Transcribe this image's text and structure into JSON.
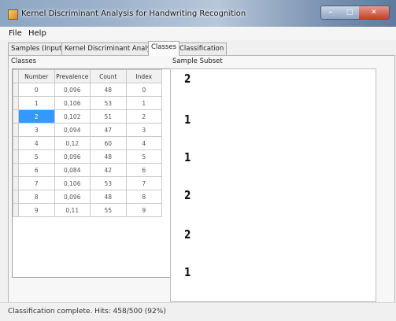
{
  "window": {
    "title": "Kernel Discriminant Analysis for Handwriting Recognition",
    "controls": {
      "minimize": "–",
      "maximize": "□",
      "close": "✕"
    }
  },
  "menu": {
    "file": "File",
    "help": "Help"
  },
  "tabs": [
    {
      "label": "Samples (Input)",
      "active": false
    },
    {
      "label": "Kernel Discriminant Analysis",
      "active": false
    },
    {
      "label": "Classes",
      "active": true
    },
    {
      "label": "Classification",
      "active": false
    }
  ],
  "classes": {
    "group_label": "Classes",
    "columns": [
      "Number",
      "Prevalence",
      "Count",
      "Index"
    ],
    "rows": [
      [
        "0",
        "0,096",
        "48",
        "0"
      ],
      [
        "1",
        "0,106",
        "53",
        "1"
      ],
      [
        "2",
        "0,102",
        "51",
        "2"
      ],
      [
        "3",
        "0,094",
        "47",
        "3"
      ],
      [
        "4",
        "0,12",
        "60",
        "4"
      ],
      [
        "5",
        "0,096",
        "48",
        "5"
      ],
      [
        "6",
        "0,084",
        "42",
        "6"
      ],
      [
        "7",
        "0,106",
        "53",
        "7"
      ],
      [
        "8",
        "0,096",
        "48",
        "8"
      ],
      [
        "9",
        "0,11",
        "55",
        "9"
      ]
    ],
    "selected_row": 2
  },
  "sample_subset": {
    "group_label": "Sample Subset",
    "digits": [
      "2",
      "1",
      "1",
      "2",
      "2",
      "1"
    ]
  },
  "status": {
    "text": "Classification complete. Hits: 458/500 (92%)"
  },
  "colors": {
    "selection": "#3399ff",
    "title_bar": "#8da6c3"
  }
}
